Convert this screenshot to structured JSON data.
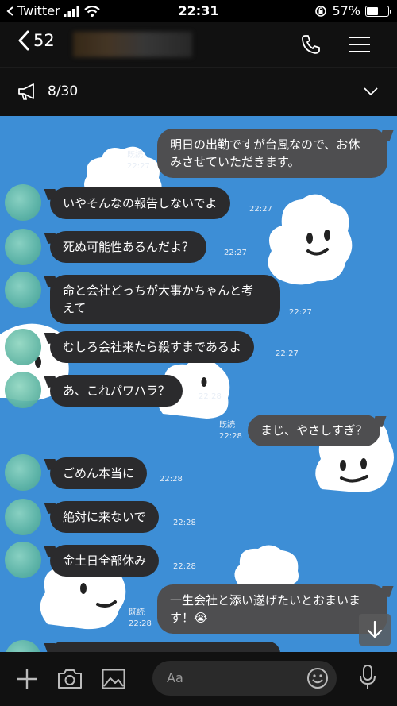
{
  "status_bar": {
    "carrier": "Twitter",
    "time": "22:31",
    "battery": "57%",
    "battery_level": 0.57
  },
  "header": {
    "back_count": "52"
  },
  "announcement": {
    "count": "8/30"
  },
  "messages": [
    {
      "side": "me",
      "text_lines": [
        "明日の出勤ですが台風なので、お休",
        "みさせていただきます。"
      ],
      "read": "既読",
      "time": "22:27"
    },
    {
      "side": "in",
      "text_lines": [
        "いやそんなの報告しないでよ"
      ],
      "time": "22:27"
    },
    {
      "side": "in",
      "text_lines": [
        "死ぬ可能性あるんだよ？"
      ],
      "time": "22:27"
    },
    {
      "side": "in",
      "text_lines": [
        "命と会社どっちが大事かちゃんと考",
        "えて"
      ],
      "time": "22:27"
    },
    {
      "side": "in",
      "text_lines": [
        "むしろ会社来たら殺すまであるよ"
      ],
      "time": "22:27"
    },
    {
      "side": "in",
      "text_lines": [
        "あ、これパワハラ？"
      ],
      "time": "22:28"
    },
    {
      "side": "me",
      "text_lines": [
        "まじ、やさしすぎ？"
      ],
      "read": "既読",
      "time": "22:28"
    },
    {
      "side": "in",
      "text_lines": [
        "ごめん本当に"
      ],
      "time": "22:28"
    },
    {
      "side": "in",
      "text_lines": [
        "絶対に来ないで"
      ],
      "time": "22:28"
    },
    {
      "side": "in",
      "text_lines": [
        "金土日全部休み"
      ],
      "time": "22:28"
    },
    {
      "side": "me",
      "text_lines": [
        "一生会社と添い遂げたいとおまいま",
        "す！😭"
      ],
      "read": "既読",
      "time": "22:28"
    }
  ],
  "input": {
    "placeholder": "Aa"
  },
  "icons": {
    "back": "chevron-left-icon",
    "call": "phone-icon",
    "menu": "hamburger-icon",
    "announcement": "megaphone-icon",
    "expand": "chevron-down-icon",
    "add": "plus-icon",
    "camera": "camera-icon",
    "image": "image-icon",
    "emoji": "smiley-icon",
    "mic": "microphone-icon",
    "scroll": "arrow-down-icon"
  },
  "colors": {
    "chat_background": "#3d8ed6",
    "incoming_bubble": "#2b2b2d",
    "outgoing_bubble": "#4e4e50"
  }
}
